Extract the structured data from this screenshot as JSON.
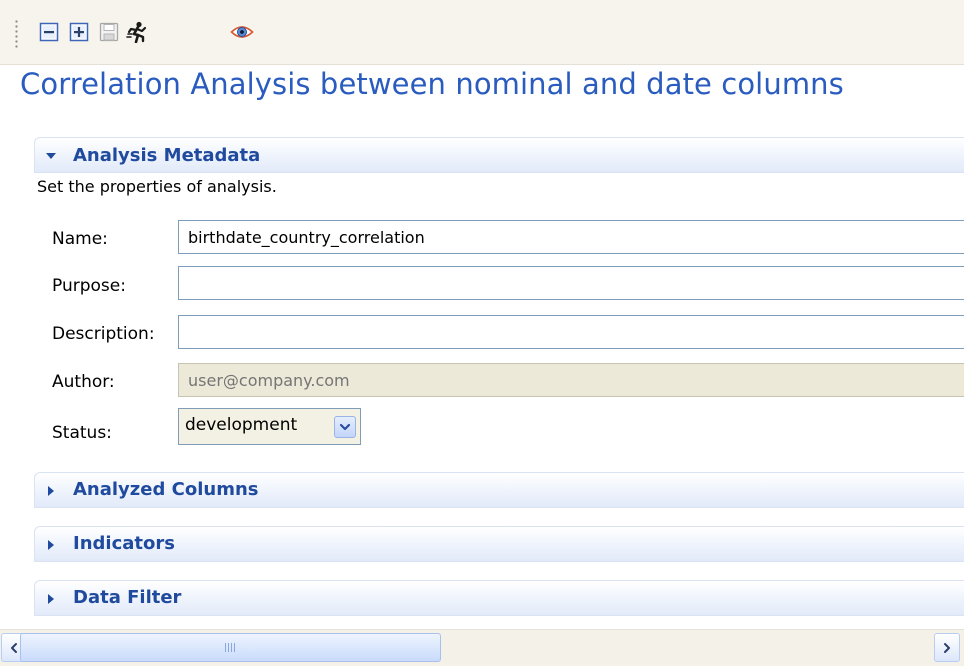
{
  "toolbar": {
    "buttons": [
      {
        "name": "collapse-all-icon"
      },
      {
        "name": "expand-all-icon"
      },
      {
        "name": "save-icon"
      },
      {
        "name": "run-icon"
      },
      {
        "name": "preview-icon"
      }
    ]
  },
  "page": {
    "title": "Correlation Analysis between nominal and date columns"
  },
  "analysis_metadata": {
    "title": "Analysis Metadata",
    "description": "Set the properties of analysis.",
    "fields": {
      "name": {
        "label": "Name:",
        "value": "birthdate_country_correlation"
      },
      "purpose": {
        "label": "Purpose:",
        "value": ""
      },
      "description": {
        "label": "Description:",
        "value": ""
      },
      "author": {
        "label": "Author:",
        "placeholder": "user@company.com"
      },
      "status": {
        "label": "Status:",
        "value": "development"
      }
    }
  },
  "sections": {
    "analyzed_columns": "Analyzed Columns",
    "indicators": "Indicators",
    "data_filter": "Data Filter"
  },
  "colors": {
    "title": "#2a5bbf",
    "section_title": "#1f4a9e",
    "toolbar_bg": "#f6f4ec"
  }
}
